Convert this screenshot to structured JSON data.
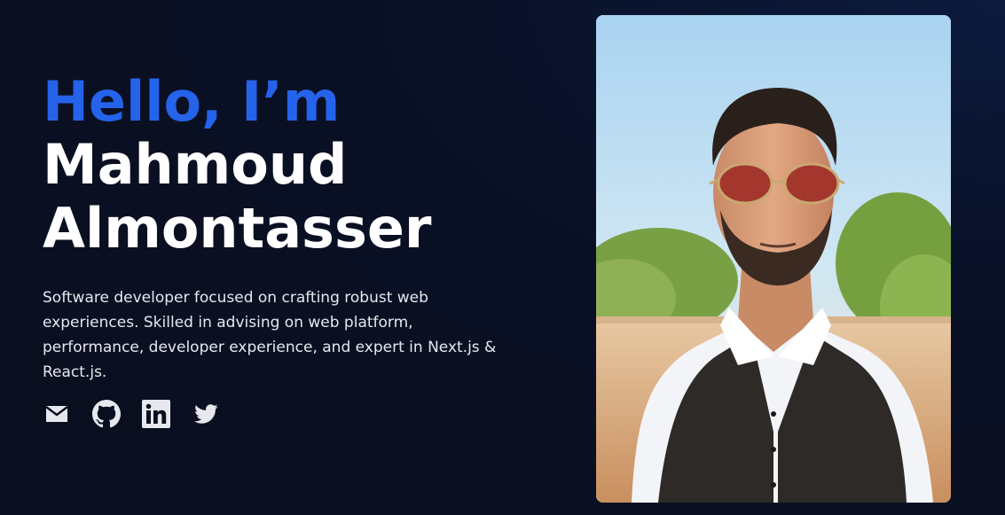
{
  "hero": {
    "greeting": "Hello, I’m",
    "name_first": "Mahmoud",
    "name_last": "Almontasser",
    "bio": "Software developer focused on crafting robust web experiences. Skilled in advising on web platform, performance, developer experience, and expert in Next.js & React.js.",
    "accent_color": "#2563eb",
    "background_color": "#0a0f1f"
  },
  "socials": [
    {
      "icon": "mail-icon"
    },
    {
      "icon": "github-icon"
    },
    {
      "icon": "linkedin-icon"
    },
    {
      "icon": "twitter-icon"
    }
  ],
  "photo": {
    "subject": "portrait"
  }
}
